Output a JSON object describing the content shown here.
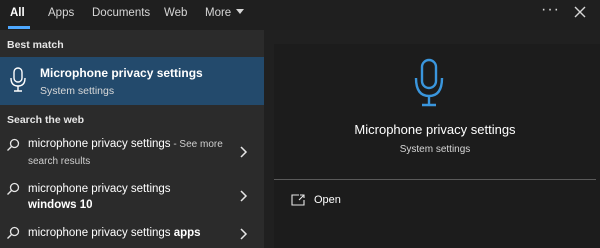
{
  "tabs": [
    {
      "label": "All",
      "active": true
    },
    {
      "label": "Apps"
    },
    {
      "label": "Documents"
    },
    {
      "label": "Web"
    },
    {
      "label": "More"
    }
  ],
  "topbar": {
    "more_options_icon": "ellipsis-icon",
    "close_icon": "close-icon"
  },
  "best_match": {
    "heading": "Best match",
    "title": "Microphone privacy settings",
    "subtitle": "System settings",
    "icon": "microphone-icon"
  },
  "web": {
    "heading": "Search the web",
    "results": [
      {
        "text": "microphone privacy settings",
        "suffix": " - See more search results"
      },
      {
        "text": "microphone privacy settings",
        "bold": "windows 10"
      },
      {
        "text": "microphone privacy settings ",
        "bold": "apps"
      }
    ]
  },
  "preview": {
    "title": "Microphone privacy settings",
    "subtitle": "System settings",
    "icon": "microphone-icon",
    "actions": [
      {
        "label": "Open",
        "icon": "open-window-icon"
      }
    ]
  },
  "colors": {
    "accent": "#4ea8ff",
    "selection": "#234a6c",
    "panel": "#2b2b2b",
    "background": "#202020"
  }
}
